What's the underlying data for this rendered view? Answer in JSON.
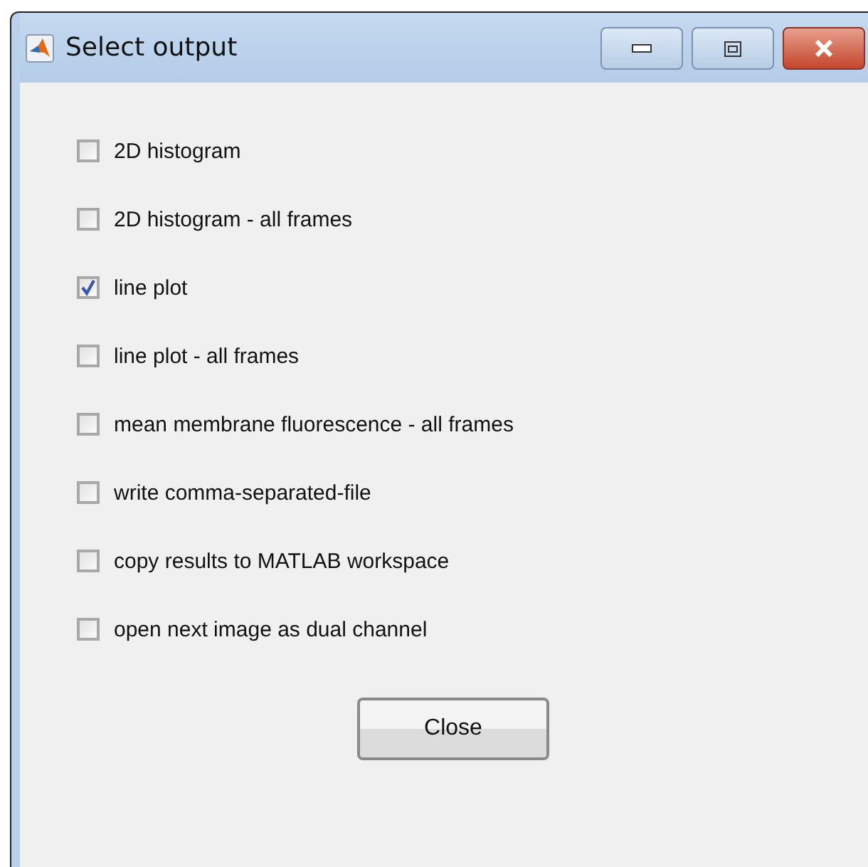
{
  "window": {
    "title": "Select output"
  },
  "options": [
    {
      "label": "2D histogram",
      "checked": false
    },
    {
      "label": "2D histogram - all frames",
      "checked": false
    },
    {
      "label": "line plot",
      "checked": true
    },
    {
      "label": "line plot - all frames",
      "checked": false
    },
    {
      "label": "mean membrane fluorescence - all frames",
      "checked": false
    },
    {
      "label": "write comma-separated-file",
      "checked": false
    },
    {
      "label": "copy results to MATLAB workspace",
      "checked": false
    },
    {
      "label": "open next image as dual channel",
      "checked": false
    }
  ],
  "buttons": [
    "Close"
  ]
}
